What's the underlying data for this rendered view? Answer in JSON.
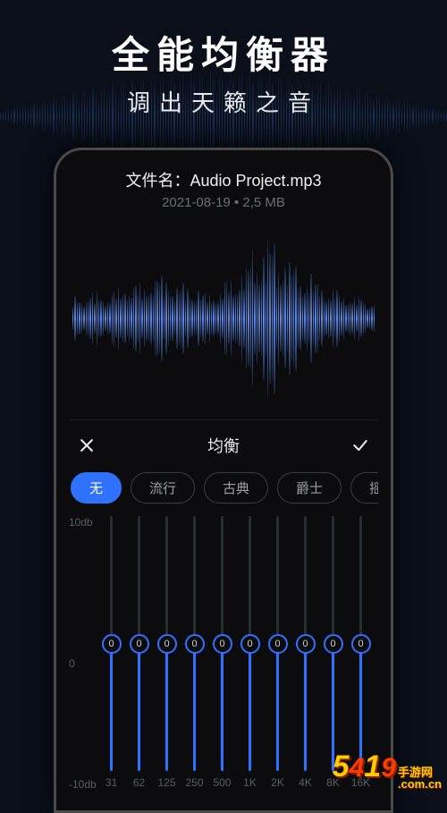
{
  "header": {
    "title": "全能均衡器",
    "subtitle": "调出天籁之音"
  },
  "file": {
    "label": "文件名：",
    "name": "Audio Project.mp3",
    "date": "2021-08-19",
    "separator": " • ",
    "size": "2,5 MB"
  },
  "panel": {
    "title": "均衡"
  },
  "presets": [
    {
      "label": "无",
      "active": true
    },
    {
      "label": "流行",
      "active": false
    },
    {
      "label": "古典",
      "active": false
    },
    {
      "label": "爵士",
      "active": false
    },
    {
      "label": "摇滚",
      "active": false
    }
  ],
  "eq": {
    "y_top": "10db",
    "y_mid": "0",
    "y_bot": "-10db",
    "bands": [
      {
        "freq": "31",
        "value": "0"
      },
      {
        "freq": "62",
        "value": "0"
      },
      {
        "freq": "125",
        "value": "0"
      },
      {
        "freq": "250",
        "value": "0"
      },
      {
        "freq": "500",
        "value": "0"
      },
      {
        "freq": "1K",
        "value": "0"
      },
      {
        "freq": "2K",
        "value": "0"
      },
      {
        "freq": "4K",
        "value": "0"
      },
      {
        "freq": "8K",
        "value": "0"
      },
      {
        "freq": "16K",
        "value": "0"
      }
    ]
  },
  "watermark": {
    "d1": "5",
    "d2": "4",
    "d3": "1",
    "d4": "9",
    "side_top": "手游网",
    "side_bot": ".com.cn"
  }
}
